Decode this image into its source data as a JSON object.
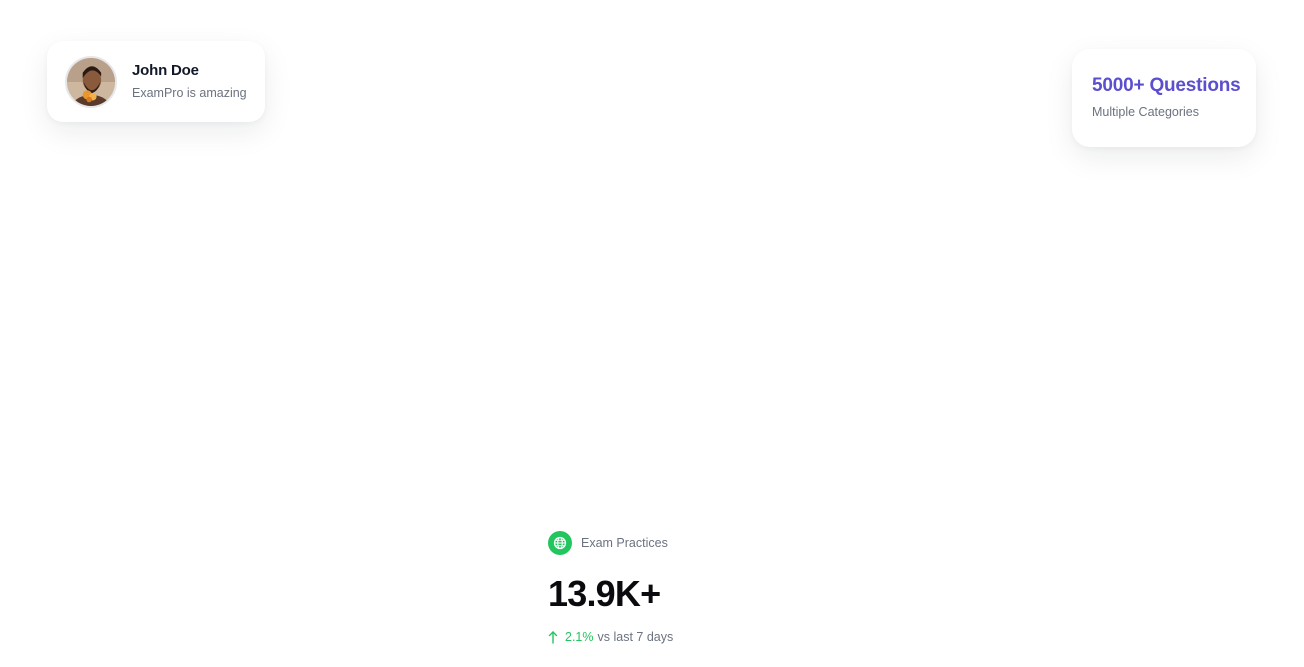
{
  "testimonial": {
    "name": "John Doe",
    "quote": "ExamPro is amazing",
    "avatar_icon": "person-avatar"
  },
  "questions_card": {
    "count": "5000+ Questions",
    "subtitle": "Multiple Categories",
    "accent_color": "#5b4fcf"
  },
  "stats": {
    "icon": "globe-icon",
    "icon_color": "#22c55e",
    "label": "Exam Practices",
    "value": "13.9K+",
    "change_icon": "arrow-up-icon",
    "change_percent": "2.1%",
    "change_suffix": "vs last 7 days",
    "positive_color": "#22c55e"
  }
}
